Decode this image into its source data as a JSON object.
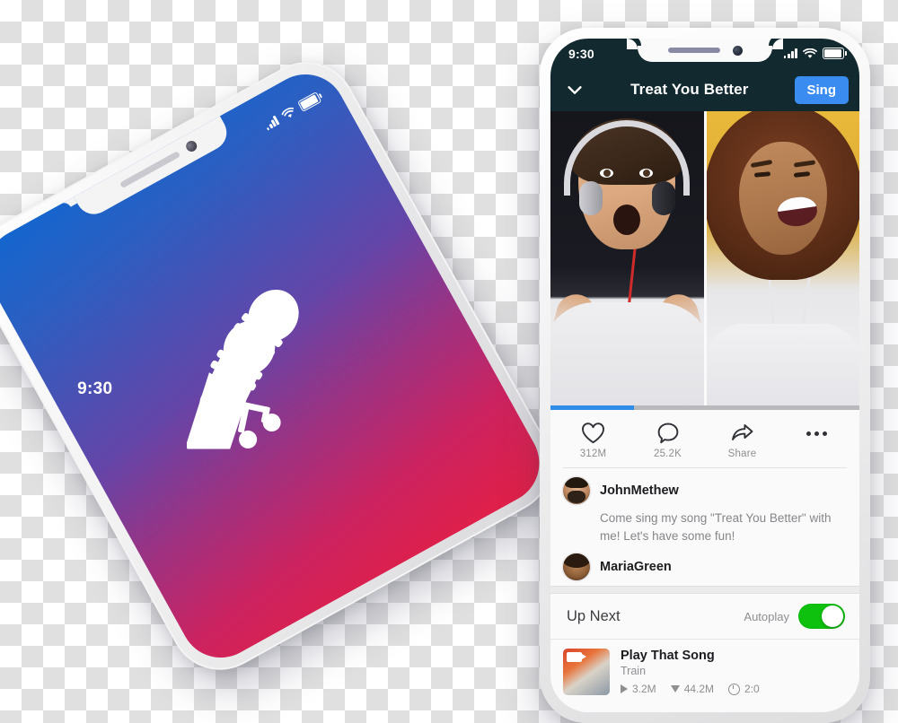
{
  "background": {
    "checker_light": "#ffffff",
    "checker_dark": "#e0e0e0"
  },
  "tilted_phone": {
    "name": "smule-splash-phone",
    "status_time": "9:30",
    "icons": [
      "signal-icon",
      "wifi-icon",
      "battery-icon"
    ],
    "logo_name": "smule-dual-microphone-logo",
    "gradient": [
      "#1266cf",
      "#6445a8",
      "#cc2360",
      "#e21f46"
    ]
  },
  "main_phone": {
    "status_bar": {
      "time": "9:30",
      "icons": [
        "signal-icon",
        "wifi-icon",
        "battery-icon"
      ],
      "background": "#12292f"
    },
    "nav_bar": {
      "back_icon": "chevron-down-icon",
      "title": "Treat You Better",
      "sing_label": "Sing",
      "sing_color": "#3b8cf0"
    },
    "video": {
      "left_performer": "man-with-headphones",
      "right_performer": "woman-singing",
      "progress_percent": 27,
      "progress_color": "#2e8de6"
    },
    "actions": [
      {
        "icon": "heart-icon",
        "label": "312M",
        "name": "like-action"
      },
      {
        "icon": "comment-icon",
        "label": "25.2K",
        "name": "comment-action"
      },
      {
        "icon": "share-icon",
        "label": "Share",
        "name": "share-action"
      },
      {
        "icon": "more-dots-icon",
        "label": "",
        "name": "more-action"
      }
    ],
    "comments": [
      {
        "avatar": "john-avatar",
        "username": "JohnMethew",
        "text": "Come sing my song \"Treat You Better\" with me! Let's have some fun!"
      },
      {
        "avatar": "maria-avatar",
        "username": "MariaGreen",
        "text": ""
      }
    ],
    "up_next": {
      "title": "Up Next",
      "autoplay_label": "Autoplay",
      "autoplay_on": true,
      "toggle_color": "#0ec10e",
      "tracks": [
        {
          "thumbnail": "play-that-song-cover",
          "title": "Play That Song",
          "artist": "Train",
          "plays": "3.2M",
          "downloads": "44.2M",
          "duration": "2:0"
        }
      ]
    }
  }
}
